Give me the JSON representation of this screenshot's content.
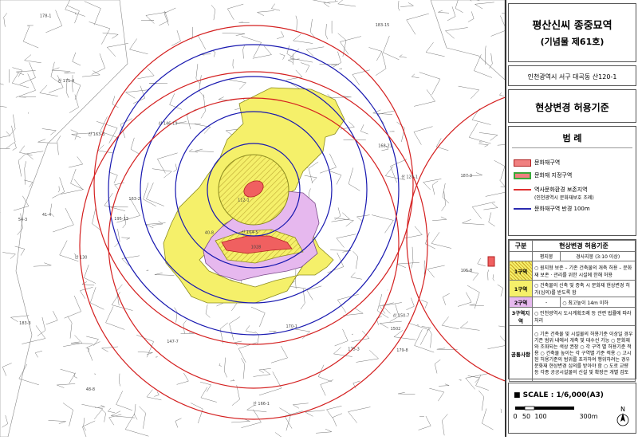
{
  "title": {
    "line1": "평산신씨 종중묘역",
    "line2": "(기념물 제61호)",
    "address": "인천광역시 서구 대곡동 산120-1",
    "subtitle": "현상변경 허용기준"
  },
  "legend": {
    "heading": "범 례",
    "items": [
      {
        "label": "문화재구역",
        "color": "#f08080"
      },
      {
        "label": "문화재 지정구역",
        "color": "#f08080"
      },
      {
        "label": "역사문화환경 보존지역",
        "color": "#e03030"
      },
      {
        "label": "(인천광역시 문화재보호 조례)",
        "color": ""
      },
      {
        "label": "문화재구역 반경 100m",
        "color": "#2a2ab0"
      }
    ]
  },
  "criteria": {
    "heading_left": "구분",
    "heading_right": "현상변경 허용기준",
    "sub_left": "평지붕",
    "sub_right": "경사지붕 (3:10 이상)",
    "rows": [
      {
        "zone": "1구역",
        "color": "#f5f06a",
        "hatch": true,
        "text": "○ 원지형 보존 – 기존 건축물의 개축 허용 – 문화재 보존 · 관리를 위한 시설에 한해 허용"
      },
      {
        "zone": "1구역",
        "color": "#f5f06a",
        "hatch": false,
        "text": "○ 건축물의 신축 및 증축 시 문화재 현상변경 허가(심의)를 받도록 함"
      },
      {
        "zone": "2구역",
        "color": "#e6b8ee",
        "hatch": false,
        "left": "-",
        "right": "○ 최고높이 14m 이하"
      },
      {
        "zone": "3구역지역",
        "color": "#ffffff",
        "hatch": false,
        "text": "○ 인천광역시 도시계획조례 등 관련 법률에 따라 처리"
      },
      {
        "zone": "공통사항",
        "color": "#ffffff",
        "hatch": false,
        "text": "○ 기존 건축물 및 시설물의 허용기준 이상일 경우 기존 범위 내에서 개축 및 대수선 가능 ○ 문화재와 조화되는 색상 권장 ○ 각 구역 별 허용기준 적용 ○ 건축물 높이는 각 구역별 기준 적용 ○ 고시된 허용기준의 범위를 초과하여 행위하려는 경우 문화재 현상변경 심의를 받아야 함 ○ 도로 교량 등 각종 공공시설물의 신설 및 확장은 개별 검토"
      }
    ]
  },
  "scale": {
    "label": "SCALE : 1/6,000(A3)",
    "ticks": [
      "0",
      "50",
      "100",
      "300m"
    ],
    "north": "N"
  },
  "map": {
    "ring_colors": {
      "historic": "#d42020",
      "buffer": "#1818b0"
    },
    "zone_colors": {
      "zone1": "#f5f06a",
      "zone2": "#e6b8ee",
      "core": "#f06060"
    },
    "parcel_labels": [
      "산 166-1",
      "산 163-3",
      "147-7",
      "1028",
      "산 164-5",
      "산 130",
      "산 120-1",
      "170-1",
      "179-8",
      "1502",
      "168-21",
      "175-3",
      "183-15",
      "40-8",
      "48-8",
      "41-4",
      "산 150-7",
      "112-1",
      "54-3",
      "산 146-19",
      "183-3",
      "187-3",
      "163-2",
      "산 171-4",
      "195-13",
      "105-8",
      "178-1"
    ]
  }
}
